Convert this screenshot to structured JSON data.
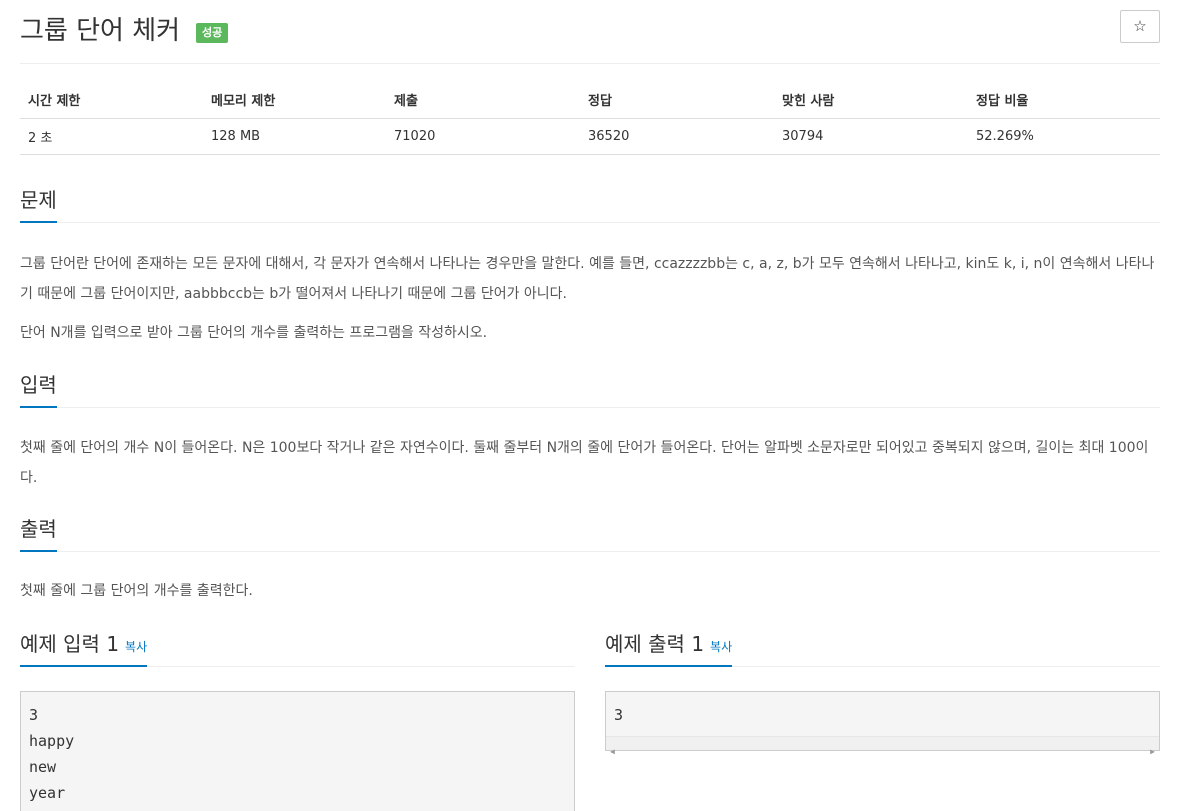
{
  "header": {
    "title": "그룹 단어 체커",
    "badge": "성공",
    "star_icon": "☆"
  },
  "stats": {
    "headers": [
      "시간 제한",
      "메모리 제한",
      "제출",
      "정답",
      "맞힌 사람",
      "정답 비율"
    ],
    "values": [
      "2 초",
      "128 MB",
      "71020",
      "36520",
      "30794",
      "52.269%"
    ]
  },
  "problem": {
    "heading": "문제",
    "paragraph1": "그룹 단어란 단어에 존재하는 모든 문자에 대해서, 각 문자가 연속해서 나타나는 경우만을 말한다. 예를 들면, ccazzzzbb는 c, a, z, b가 모두 연속해서 나타나고, kin도 k, i, n이 연속해서 나타나기 때문에 그룹 단어이지만, aabbbccb는 b가 떨어져서 나타나기 때문에 그룹 단어가 아니다.",
    "paragraph2": "단어 N개를 입력으로 받아 그룹 단어의 개수를 출력하는 프로그램을 작성하시오."
  },
  "input": {
    "heading": "입력",
    "text": "첫째 줄에 단어의 개수 N이 들어온다. N은 100보다 작거나 같은 자연수이다. 둘째 줄부터 N개의 줄에 단어가 들어온다. 단어는 알파벳 소문자로만 되어있고 중복되지 않으며, 길이는 최대 100이다."
  },
  "output": {
    "heading": "출력",
    "text": "첫째 줄에 그룹 단어의 개수를 출력한다."
  },
  "sample_input": {
    "heading": "예제 입력 1",
    "copy_label": "복사",
    "lines": [
      "3",
      "happy",
      "new",
      "year"
    ]
  },
  "sample_output": {
    "heading": "예제 출력 1",
    "copy_label": "복사",
    "lines": [
      "3"
    ]
  }
}
